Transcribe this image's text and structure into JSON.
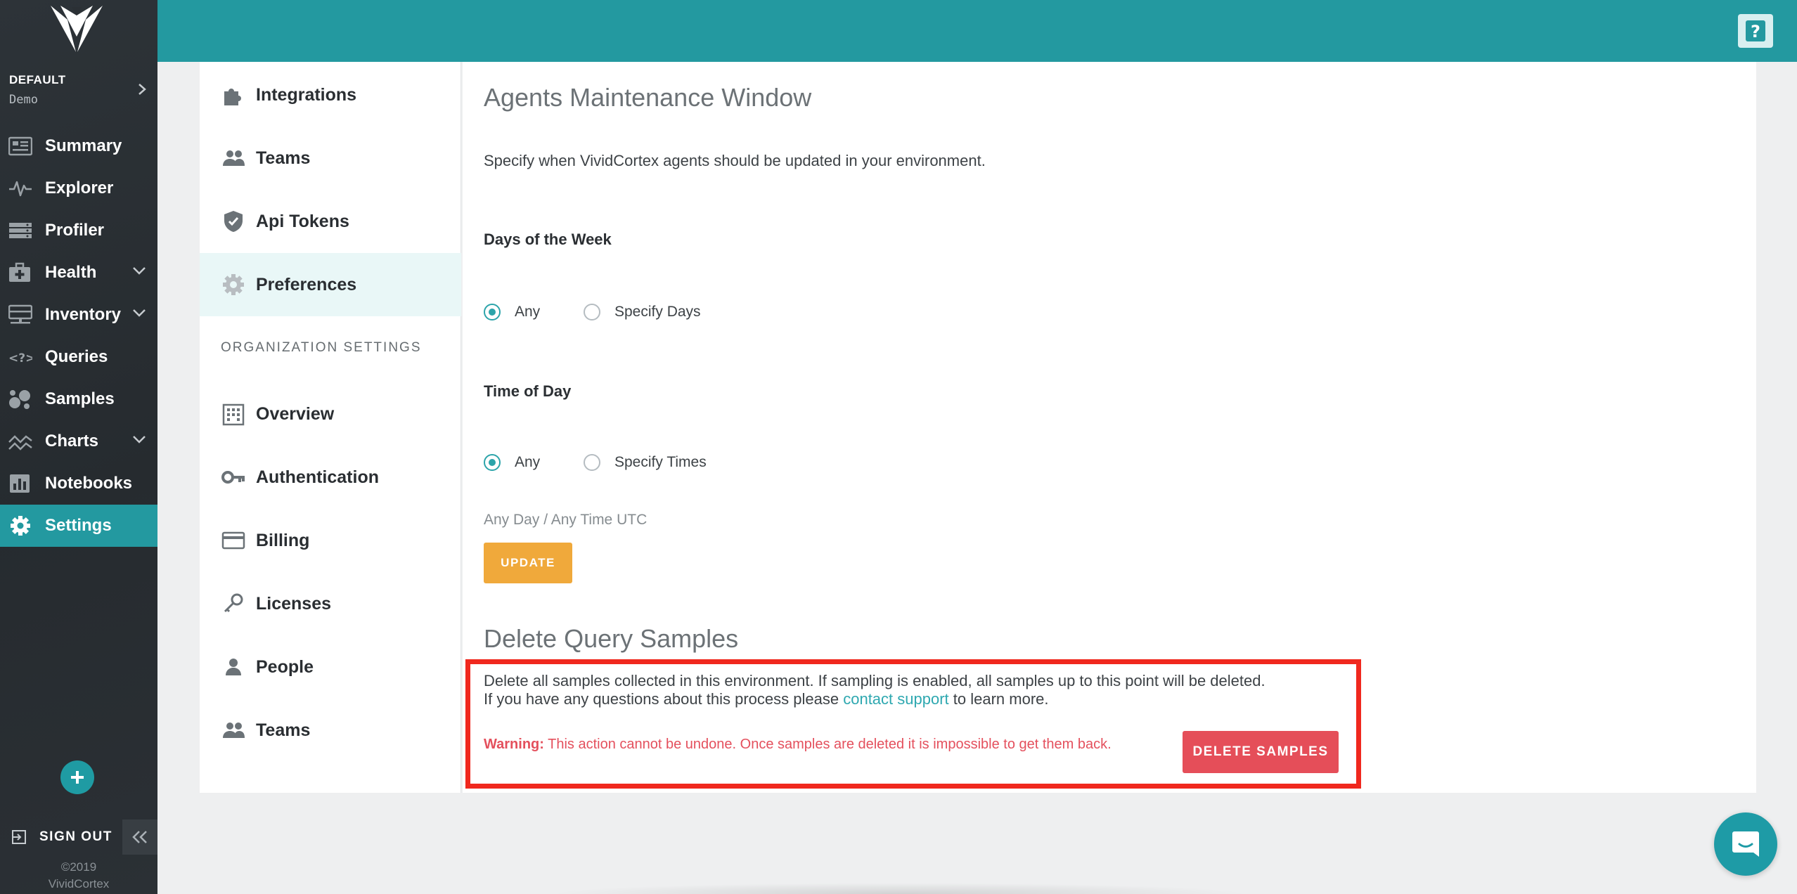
{
  "nav": {
    "env_name": "DEFAULT",
    "env_sub": "Demo",
    "items": [
      {
        "label": "Summary",
        "icon": "summary-icon",
        "expandable": false
      },
      {
        "label": "Explorer",
        "icon": "explorer-icon",
        "expandable": false
      },
      {
        "label": "Profiler",
        "icon": "profiler-icon",
        "expandable": false
      },
      {
        "label": "Health",
        "icon": "health-icon",
        "expandable": true
      },
      {
        "label": "Inventory",
        "icon": "inventory-icon",
        "expandable": true
      },
      {
        "label": "Queries",
        "icon": "queries-icon",
        "expandable": false
      },
      {
        "label": "Samples",
        "icon": "samples-icon",
        "expandable": false
      },
      {
        "label": "Charts",
        "icon": "charts-icon",
        "expandable": true
      },
      {
        "label": "Notebooks",
        "icon": "notebooks-icon",
        "expandable": false
      },
      {
        "label": "Settings",
        "icon": "settings-icon",
        "expandable": false,
        "active": true
      }
    ],
    "sign_out": "SIGN OUT",
    "copyright_year": "©2019",
    "copyright_company": "VividCortex"
  },
  "submenu": {
    "items": [
      {
        "label": "Integrations",
        "icon": "puzzle-icon"
      },
      {
        "label": "Teams",
        "icon": "people-icon"
      },
      {
        "label": "Api Tokens",
        "icon": "shield-icon"
      },
      {
        "label": "Preferences",
        "icon": "gear-icon",
        "active": true
      }
    ],
    "org_heading": "ORGANIZATION SETTINGS",
    "org_items": [
      {
        "label": "Overview",
        "icon": "building-icon"
      },
      {
        "label": "Authentication",
        "icon": "key-icon"
      },
      {
        "label": "Billing",
        "icon": "credit-card-icon"
      },
      {
        "label": "Licenses",
        "icon": "license-key-icon"
      },
      {
        "label": "People",
        "icon": "person-icon"
      },
      {
        "label": "Teams",
        "icon": "people-icon"
      }
    ]
  },
  "maintenance": {
    "title": "Agents Maintenance Window",
    "description": "Specify when VividCortex agents should be updated in your environment.",
    "days_heading": "Days of the Week",
    "days_options": [
      "Any",
      "Specify Days"
    ],
    "days_selected": "Any",
    "time_heading": "Time of Day",
    "time_options": [
      "Any",
      "Specify Times"
    ],
    "time_selected": "Any",
    "summary": "Any Day / Any Time UTC",
    "update_label": "UPDATE"
  },
  "delete_samples": {
    "title": "Delete Query Samples",
    "line1": "Delete all samples collected in this environment. If sampling is enabled, all samples up to this point will be deleted.",
    "line2_prefix": "If you have any questions about this process please ",
    "line2_link": "contact support",
    "line2_suffix": " to learn more.",
    "warning_label": "Warning:",
    "warning_text": " This action cannot be undone. Once samples are deleted it is impossible to get them back.",
    "button_label": "DELETE SAMPLES"
  },
  "colors": {
    "teal": "#2399a0",
    "nav_bg": "#2b3035",
    "update_btn": "#f0a93b",
    "delete_btn": "#e54e59",
    "highlight": "#f0281e"
  }
}
